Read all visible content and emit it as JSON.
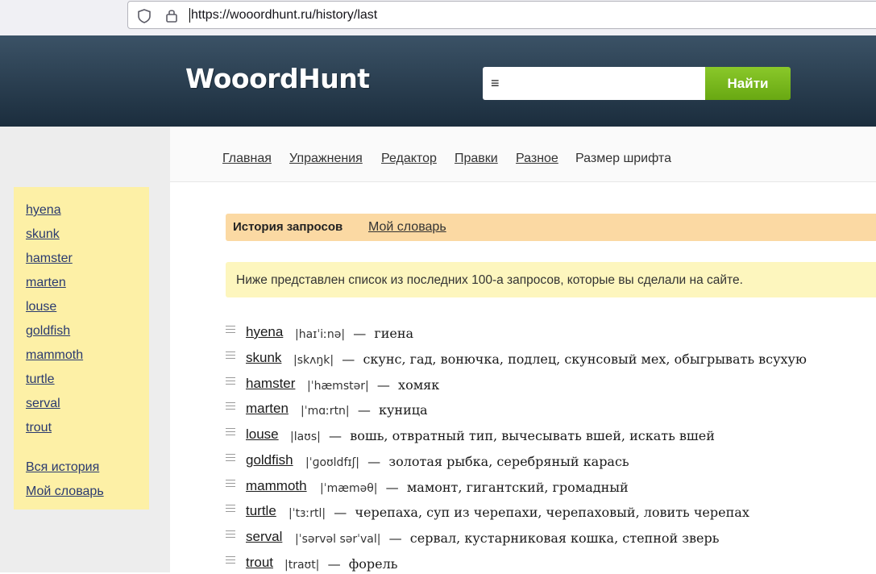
{
  "browser": {
    "url": "https://wooordhunt.ru/history/last"
  },
  "header": {
    "logo": "WooordHunt",
    "search_glyph": "≡",
    "search_placeholder": "",
    "search_button": "Найти"
  },
  "nav": {
    "items": [
      "Главная",
      "Упражнения",
      "Редактор",
      "Правки",
      "Разное",
      "Размер шрифта"
    ]
  },
  "sidebar": {
    "words": [
      "hyena",
      "skunk",
      "hamster",
      "marten",
      "louse",
      "goldfish",
      "mammoth",
      "turtle",
      "serval",
      "trout"
    ],
    "all_history": "Вся история",
    "my_dictionary": "Мой словарь"
  },
  "tabs": {
    "active": "История запросов",
    "link": "Мой словарь"
  },
  "info": "Ниже представлен список из последних 100-а запросов, которые вы сделали на сайте.",
  "history": [
    {
      "word": "hyena",
      "transcription": "|haɪˈiːnə|",
      "translation": "гиена"
    },
    {
      "word": "skunk",
      "transcription": "|skʌŋk|",
      "translation": "скунс, гад, вонючка, подлец, скунсовый мех, обыгрывать всухую"
    },
    {
      "word": "hamster",
      "transcription": "|ˈhæmstər|",
      "translation": "хомяк"
    },
    {
      "word": "marten",
      "transcription": "|ˈmɑːrtn|",
      "translation": "куница"
    },
    {
      "word": "louse",
      "transcription": "|laʊs|",
      "translation": "вошь, отвратный тип, вычесывать вшей, искать вшей"
    },
    {
      "word": "goldfish",
      "transcription": "|ˈɡoʊldfɪʃ|",
      "translation": "золотая рыбка, серебряный карась"
    },
    {
      "word": "mammoth",
      "transcription": "|ˈmæməθ|",
      "translation": "мамонт, гигантский, громадный"
    },
    {
      "word": "turtle",
      "transcription": "|ˈtɜːrtl|",
      "translation": "черепаха, суп из черепахи, черепаховый, ловить черепах"
    },
    {
      "word": "serval",
      "transcription": "|ˈsərvəl sərˈval|",
      "translation": "сервал, кустарниковая кошка, степной зверь"
    },
    {
      "word": "trout",
      "transcription": "|traʊt|",
      "translation": "форель"
    }
  ],
  "dash": "—",
  "colors": {
    "header_top": "#3b5266",
    "header_bottom": "#1b2d3d",
    "search_button": "#7cbb1f",
    "sidebar_bg": "#fdf0a6",
    "tabs_bg": "#fbd9a3",
    "info_bg": "#fdf6be"
  }
}
